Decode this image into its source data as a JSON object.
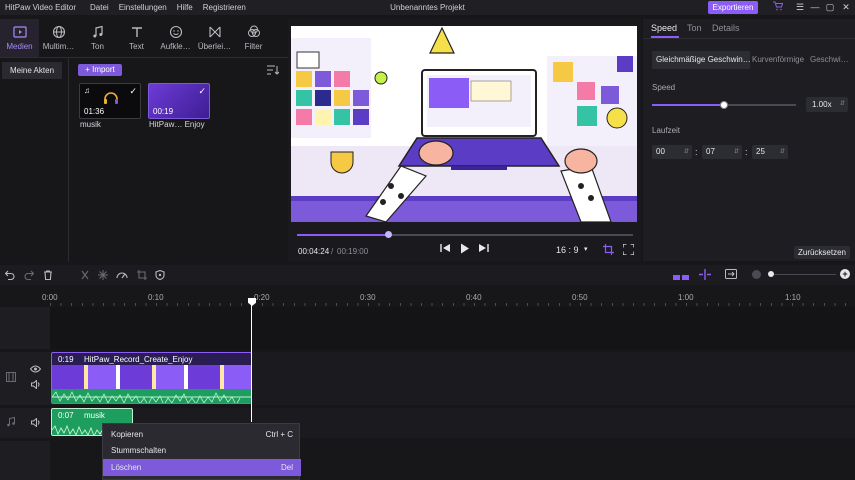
{
  "titlebar": {
    "app_name": "HitPaw Video Editor",
    "menu": [
      "Datei",
      "Einstellungen",
      "Hilfe",
      "Registrieren"
    ],
    "project_title": "Unbenanntes Projekt",
    "export_label": "Exportieren",
    "cart_icon": "cart-icon",
    "menu_icon": "hamburger-menu-icon",
    "minimize_icon": "minimize-icon",
    "maximize_icon": "maximize-icon",
    "close_icon": "close-icon",
    "export_color": "#8b5cf6"
  },
  "toolbar": {
    "tools": [
      {
        "label": "Medien",
        "icon": "media-icon",
        "active": true
      },
      {
        "label": "Multim…",
        "icon": "globe-icon",
        "active": false
      },
      {
        "label": "Ton",
        "icon": "music-note-icon",
        "active": false
      },
      {
        "label": "Text",
        "icon": "text-icon",
        "active": false
      },
      {
        "label": "Aufkle…",
        "icon": "sticker-icon",
        "active": false
      },
      {
        "label": "Überlei…",
        "icon": "transition-icon",
        "active": false
      },
      {
        "label": "Filter",
        "icon": "filter-icon",
        "active": false
      }
    ]
  },
  "media": {
    "sidebar_item": "Meine Akten",
    "import_label": "+ Import",
    "sort_icon": "sort-icon",
    "items": [
      {
        "name": "musik",
        "duration": "01:36",
        "kind": "audio"
      },
      {
        "name": "HitPaw… Enjoy",
        "duration": "00:19",
        "kind": "video"
      }
    ]
  },
  "player": {
    "current_time": "00:04:24",
    "separator": "/",
    "total_time": "00:19:00",
    "progress": 0.27,
    "aspect_ratio": "16 : 9",
    "prev_icon": "skip-back-icon",
    "play_icon": "play-icon",
    "next_icon": "skip-forward-icon",
    "crop_icon": "crop-icon",
    "fullscreen_icon": "fullscreen-icon"
  },
  "right_panel": {
    "tabs": [
      "Speed",
      "Ton",
      "Details"
    ],
    "active_tab": "Speed",
    "speed_modes": [
      "Gleichmäßige Geschwin…",
      "Kurvenförmige",
      "Geschwi…"
    ],
    "speed_label": "Speed",
    "speed_value": "1.00x",
    "speed_fraction": 0.5,
    "duration_label": "Laufzeit",
    "duration": {
      "h": "00",
      "m": "07",
      "s": "25"
    },
    "reset_label": "Zurücksetzen"
  },
  "timeline": {
    "toolbar_icons": [
      "undo-icon",
      "redo-icon",
      "delete-icon",
      "split-icon",
      "freeze-icon",
      "speed-icon",
      "crop-icon",
      "mask-icon"
    ],
    "ruler_labels": [
      "0:00",
      "0:10",
      "0:20",
      "0:30",
      "0:40",
      "0:50",
      "1:00",
      "1:10"
    ],
    "playhead_time": "0:20",
    "video_clip": {
      "duration": "0:19",
      "title": "HitPaw_Record_Create_Enjoy"
    },
    "audio_clip": {
      "duration": "0:07",
      "title": "musik"
    }
  },
  "context_menu": {
    "items": [
      {
        "label": "Kopieren",
        "shortcut": "Ctrl + C",
        "highlighted": false
      },
      {
        "label": "Stummschalten",
        "shortcut": "",
        "highlighted": false
      },
      {
        "label": "Löschen",
        "shortcut": "Del",
        "highlighted": true
      }
    ]
  }
}
